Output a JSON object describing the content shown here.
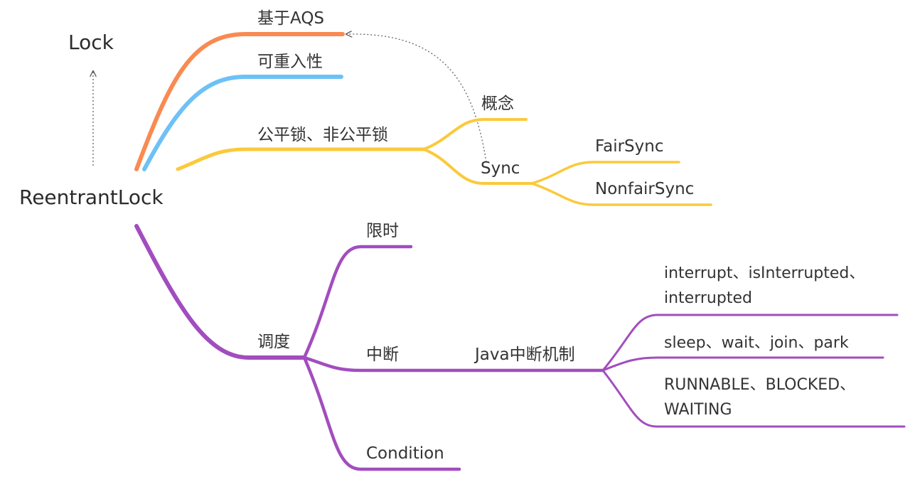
{
  "root": {
    "label": "ReentrantLock"
  },
  "parent": {
    "label": "Lock"
  },
  "branches": {
    "aqs": {
      "label": "基于AQS",
      "color": "#f98a52"
    },
    "reentrant": {
      "label": "可重入性",
      "color": "#6ec1f7"
    },
    "fairness": {
      "label": "公平锁、非公平锁",
      "color": "#fbc93b",
      "concept": {
        "label": "概念"
      },
      "sync": {
        "label": "Sync",
        "fair": {
          "label": "FairSync"
        },
        "nonfair": {
          "label": "NonfairSync"
        }
      }
    },
    "schedule": {
      "label": "调度",
      "color": "#a24dbf",
      "timed": {
        "label": "限时"
      },
      "interrupt": {
        "label": "中断",
        "java": {
          "label": "Java中断机制",
          "methods": [
            "interrupt、isInterrupted、",
            "interrupted"
          ],
          "blocking": "sleep、wait、join、park",
          "states": [
            "RUNNABLE、BLOCKED、",
            "WAITING"
          ]
        }
      },
      "condition": {
        "label": "Condition"
      }
    }
  }
}
